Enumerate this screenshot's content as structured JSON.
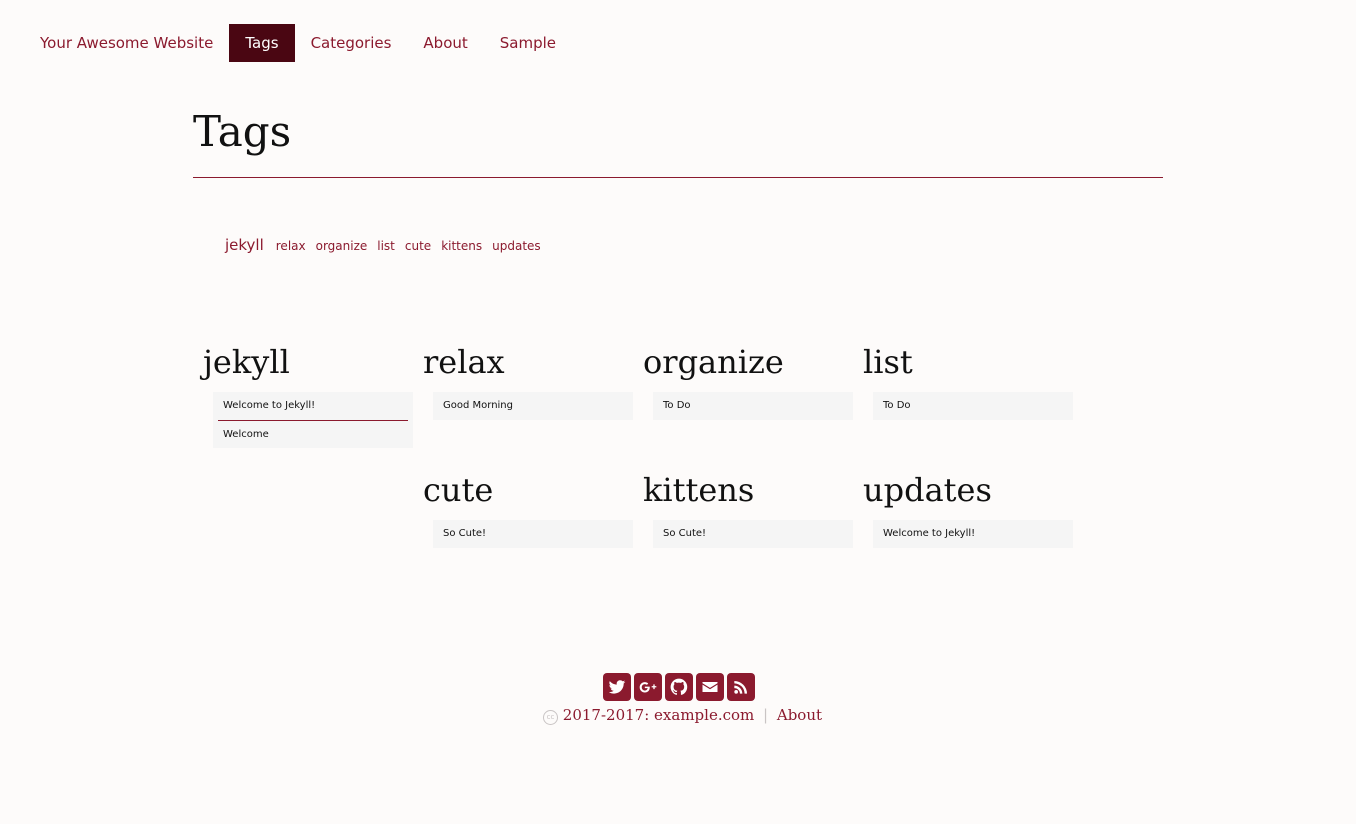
{
  "nav": {
    "brand": "Your Awesome Website",
    "items": [
      {
        "label": "Tags",
        "active": true
      },
      {
        "label": "Categories",
        "active": false
      },
      {
        "label": "About",
        "active": false
      },
      {
        "label": "Sample",
        "active": false
      }
    ]
  },
  "page": {
    "title": "Tags"
  },
  "tag_cloud": [
    "jekyll",
    "relax",
    "organize",
    "list",
    "cute",
    "kittens",
    "updates"
  ],
  "tags": [
    {
      "name": "jekyll",
      "posts": [
        "Welcome to Jekyll!",
        "Welcome"
      ]
    },
    {
      "name": "relax",
      "posts": [
        "Good Morning"
      ]
    },
    {
      "name": "organize",
      "posts": [
        "To Do"
      ]
    },
    {
      "name": "list",
      "posts": [
        "To Do"
      ]
    },
    {
      "name": "cute",
      "posts": [
        "So Cute!"
      ]
    },
    {
      "name": "kittens",
      "posts": [
        "So Cute!"
      ]
    },
    {
      "name": "updates",
      "posts": [
        "Welcome to Jekyll!"
      ]
    }
  ],
  "footer": {
    "social_icons": [
      "twitter-icon",
      "google-plus-icon",
      "github-icon",
      "envelope-icon",
      "rss-icon"
    ],
    "cc_label": "cc",
    "years": "2017-2017",
    "colon": ":",
    "site": "example.com",
    "separator": "|",
    "about": "About"
  },
  "colors": {
    "accent": "#8b1a2e",
    "nav_active_bg": "#4a0612",
    "background": "#fdfbfa",
    "post_bg": "#f5f5f5"
  }
}
